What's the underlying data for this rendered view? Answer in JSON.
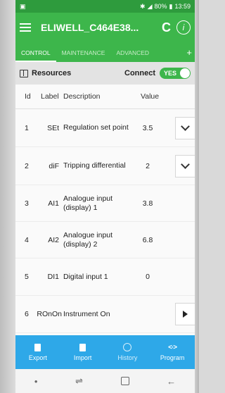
{
  "status_bar": {
    "left_icon": "image-icon",
    "right_text": "80%",
    "time": "13:59"
  },
  "app_bar": {
    "title": "ELIWELL_C464E38...",
    "menu_icon": "hamburger-icon",
    "refresh_icon": "refresh-icon",
    "info_icon": "info-icon"
  },
  "tabs": [
    {
      "label": "CONTROL",
      "active": true
    },
    {
      "label": "MAINTENANCE",
      "active": false
    },
    {
      "label": "ADVANCED",
      "active": false
    }
  ],
  "tab_plus": "+",
  "resources": {
    "title": "Resources",
    "connect_label": "Connect",
    "toggle_label": "YES"
  },
  "table": {
    "headers": {
      "id": "Id",
      "label": "Label",
      "description": "Description",
      "value": "Value"
    },
    "rows": [
      {
        "id": "1",
        "label": "SEt",
        "description": "Regulation set point",
        "value": "3.5",
        "action": "chevron-down"
      },
      {
        "id": "2",
        "label": "diF",
        "description": "Tripping differential",
        "value": "2",
        "action": "chevron-down"
      },
      {
        "id": "3",
        "label": "AI1",
        "description": "Analogue input (display) 1",
        "value": "3.8",
        "action": ""
      },
      {
        "id": "4",
        "label": "AI2",
        "description": "Analogue input (display) 2",
        "value": "6.8",
        "action": ""
      },
      {
        "id": "5",
        "label": "DI1",
        "description": "Digital input 1",
        "value": "0",
        "action": ""
      },
      {
        "id": "6",
        "label": "ROnOn",
        "description": "Instrument On",
        "value": "",
        "action": "play"
      }
    ]
  },
  "bottom_nav": [
    {
      "label": "Export",
      "icon": "export-icon"
    },
    {
      "label": "Import",
      "icon": "import-icon"
    },
    {
      "label": "History",
      "icon": "clock-icon"
    },
    {
      "label": "Program",
      "icon": "code-icon"
    }
  ],
  "colors": {
    "primary_green": "#3db64b",
    "status_green": "#2e9b3d",
    "nav_blue": "#2ea8e8"
  }
}
